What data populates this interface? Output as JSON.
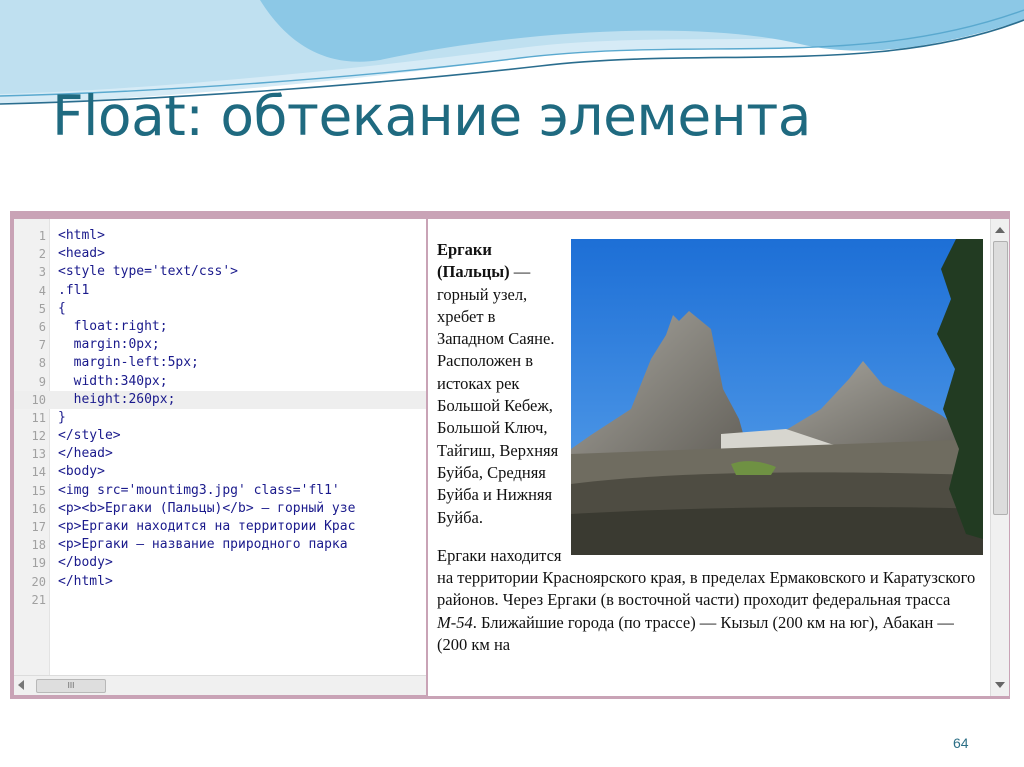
{
  "slide": {
    "title": "Float: обтекание элемента",
    "page_number": "64"
  },
  "colors": {
    "title": "#1f6a80",
    "frame": "#c9a3b6",
    "tag_blue": "#1a1a8c",
    "value_magenta": "#c2185b"
  },
  "editor": {
    "lines": [
      {
        "n": "1",
        "text": "<html>"
      },
      {
        "n": "2",
        "text": "<head>"
      },
      {
        "n": "3",
        "text": "<style type='text/css'>"
      },
      {
        "n": "4",
        "text": ".fl1"
      },
      {
        "n": "5",
        "text": "{"
      },
      {
        "n": "6",
        "text": "  float:right;"
      },
      {
        "n": "7",
        "text": "  margin:0px;"
      },
      {
        "n": "8",
        "text": "  margin-left:5px;"
      },
      {
        "n": "9",
        "text": "  width:340px;"
      },
      {
        "n": "10",
        "text": "  height:260px;"
      },
      {
        "n": "11",
        "text": "}"
      },
      {
        "n": "12",
        "text": "</style>"
      },
      {
        "n": "13",
        "text": "</head>"
      },
      {
        "n": "14",
        "text": "<body>"
      },
      {
        "n": "15",
        "text": "<img src='mountimg3.jpg' class='fl1'"
      },
      {
        "n": "16",
        "text": "<p><b>Ергаки (Пальцы)</b> — горный узе"
      },
      {
        "n": "17",
        "text": "<p>Ергаки находится на территории Крас"
      },
      {
        "n": "18",
        "text": "<p>Ергаки — название природного парка"
      },
      {
        "n": "19",
        "text": "</body>"
      },
      {
        "n": "20",
        "text": "</html>"
      },
      {
        "n": "21",
        "text": ""
      }
    ],
    "scroll_thumb_label": "III"
  },
  "preview": {
    "photo_icon": "mountain-photo",
    "p1_bold": "Ергаки (Пальцы)",
    "p1_rest": " — горный узел, хребет в Западном Саяне. Расположен в истоках рек Большой Кебеж, Большой Ключ, Тайгиш, Верхняя Буйба, Средняя Буйба и Нижняя Буйба.",
    "p2_text": "Ергаки находится на территории Красноярского края, в пределах Ермаковского и Каратузского районов. Через Ергаки (в восточной части) проходит федеральная трасса ",
    "p2_route": "М-54",
    "p2_tail": ". Ближайшие города (по трассе) — Кызыл (200 км на юг), Абакан — (200 км на"
  }
}
